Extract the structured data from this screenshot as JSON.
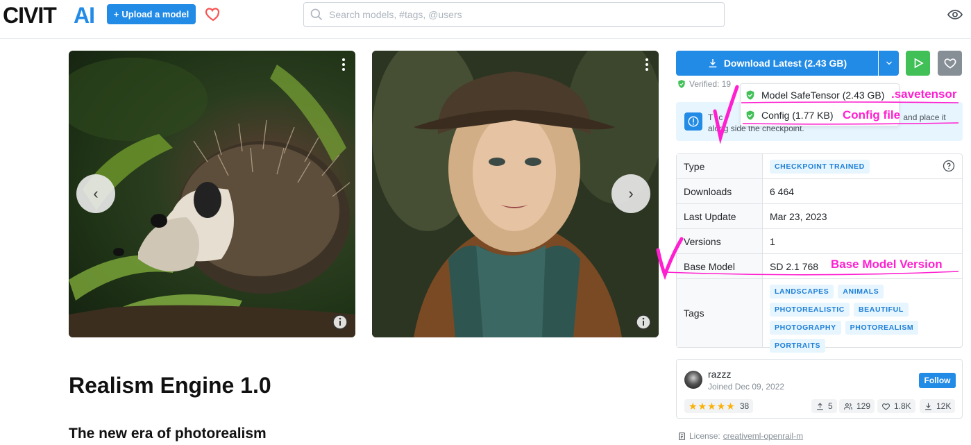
{
  "header": {
    "logo_text": "CIVITAI",
    "upload_label": "Upload a model",
    "search_placeholder": "Search models, #tags, @users"
  },
  "gallery": {
    "images": [
      {
        "subject": "hedgehog"
      },
      {
        "subject": "woman-in-hat"
      }
    ]
  },
  "model": {
    "title": "Realism Engine 1.0",
    "subtitle": "The new era of photorealism"
  },
  "download": {
    "label": "Download Latest (2.43 GB)",
    "verified": "Verified: 19",
    "files": [
      {
        "label": "Model SafeTensor (2.43 GB)"
      },
      {
        "label": "Config (1.77 KB)"
      }
    ]
  },
  "notice": {
    "text_a": "T",
    "text_b": "c",
    "text_c": "and place it",
    "text_d": "along side the checkpoint."
  },
  "details": {
    "type_label": "Type",
    "type_value": "CHECKPOINT TRAINED",
    "downloads_label": "Downloads",
    "downloads_value": "6 464",
    "updated_label": "Last Update",
    "updated_value": "Mar 23, 2023",
    "versions_label": "Versions",
    "versions_value": "1",
    "base_label": "Base Model",
    "base_value": "SD 2.1 768",
    "tags_label": "Tags",
    "tags": [
      "LANDSCAPES",
      "ANIMALS",
      "PHOTOREALISTIC",
      "BEAUTIFUL",
      "PHOTOGRAPHY",
      "PHOTOREALISM",
      "PORTRAITS"
    ]
  },
  "creator": {
    "name": "razzz",
    "joined": "Joined Dec 09, 2022",
    "follow_label": "Follow",
    "rating_count": "38",
    "uploads": "5",
    "followers": "129",
    "favorites": "1.8K",
    "downloads": "12K"
  },
  "license": {
    "label": "License:",
    "value": "creativeml-openrail-m"
  },
  "annotations": {
    "safetensor": ".savetensor",
    "config": "Config file",
    "base_model": "Base Model Version"
  },
  "colors": {
    "primary": "#228be6",
    "green": "#40c057",
    "annotation": "#ff1fd0"
  }
}
